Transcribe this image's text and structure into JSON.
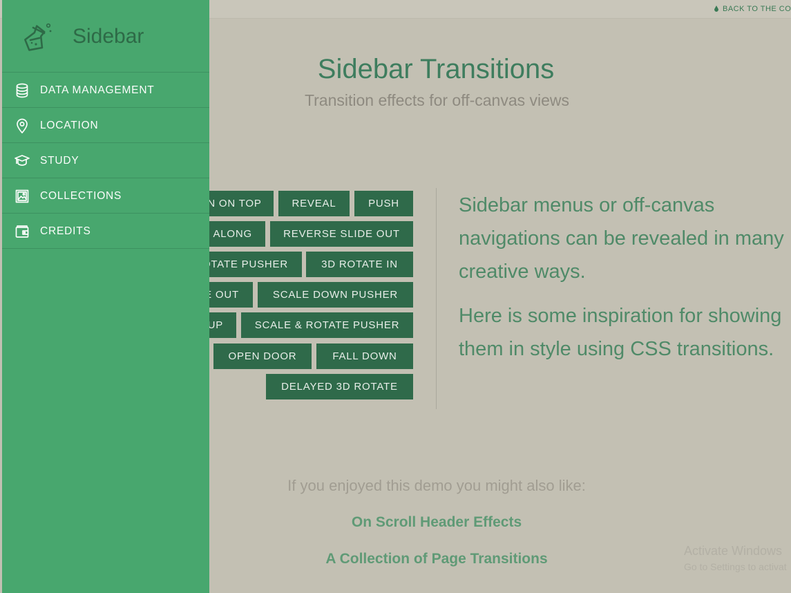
{
  "topbar": {
    "back_link": "BACK TO THE CO"
  },
  "header": {
    "title": "Sidebar Transitions",
    "subtitle": "Transition effects for off-canvas views"
  },
  "buttons": {
    "slide_in_on_top": "N ON TOP",
    "reveal": "REVEAL",
    "push": "PUSH",
    "slide_along": "ALONG",
    "reverse_slide_out": "REVERSE SLIDE OUT",
    "rotate_pusher": "OTATE PUSHER",
    "rotate_in_3d": "3D ROTATE IN",
    "rotate_out_3d": "E OUT",
    "scale_down_pusher": "SCALE DOWN PUSHER",
    "scale_up": "UP",
    "scale_rotate_pusher": "SCALE & ROTATE PUSHER",
    "open_door": "OPEN DOOR",
    "fall_down": "FALL DOWN",
    "delayed_3d_rotate": "DELAYED 3D ROTATE"
  },
  "blurb": {
    "para1": "Sidebar menus or off-canvas navigations can be revealed in many creative ways.",
    "para2": "Here is some inspiration for showing them in style using CSS transitions."
  },
  "related": {
    "intro": "If you enjoyed this demo you might also like:",
    "link1": "On Scroll Header Effects",
    "link2": "A Collection of Page Transitions"
  },
  "watermark": {
    "line1": "Activate Windows",
    "line2": "Go to Settings to activat"
  },
  "sidebar": {
    "brand": "Sidebar",
    "brand_icon": "flask-icon",
    "items": [
      {
        "label": "DATA MANAGEMENT",
        "icon": "database-icon"
      },
      {
        "label": "LOCATION",
        "icon": "map-pin-icon"
      },
      {
        "label": "STUDY",
        "icon": "graduation-cap-icon"
      },
      {
        "label": "COLLECTIONS",
        "icon": "image-collection-icon"
      },
      {
        "label": "CREDITS",
        "icon": "wallet-icon"
      }
    ]
  },
  "colors": {
    "sidebar_bg": "#48a76e",
    "page_bg": "#c3c0b3",
    "button_bg": "#2f6a4a",
    "accent_text": "#3e7d5e"
  }
}
